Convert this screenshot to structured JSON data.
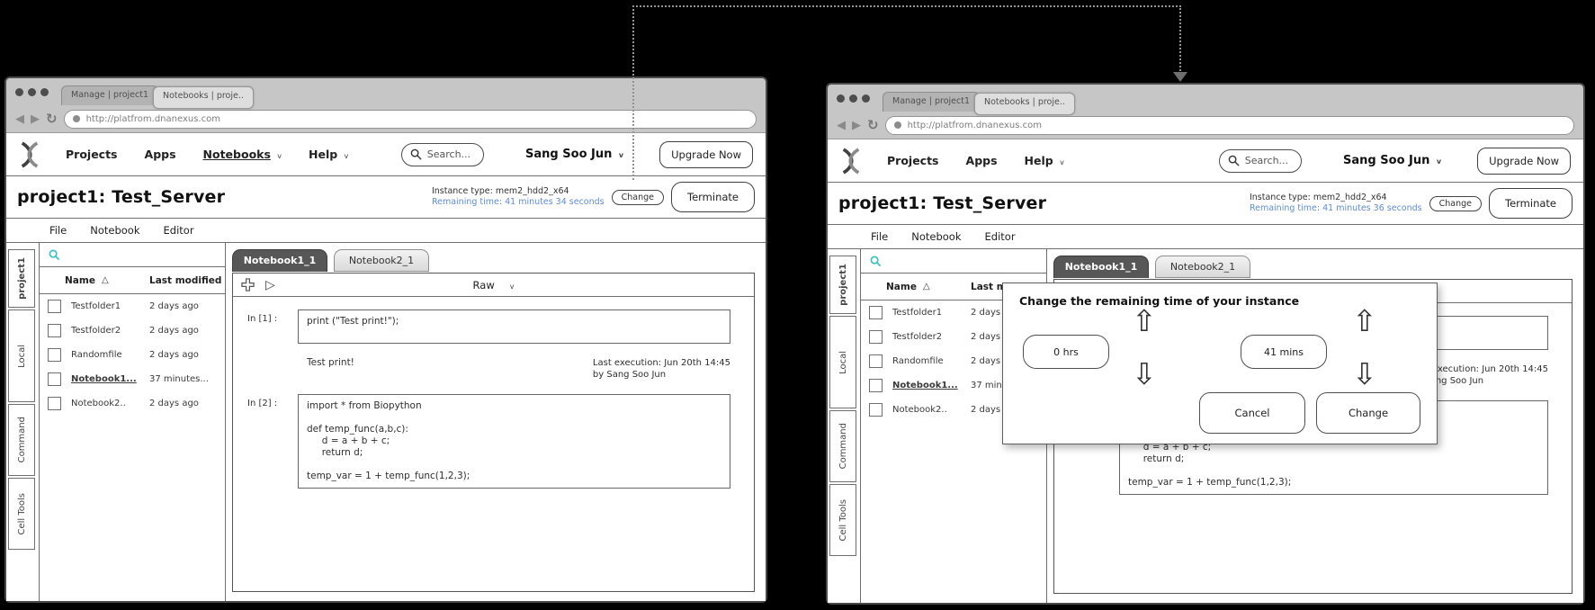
{
  "colors": {
    "link_blue": "#5f8dd3",
    "file_search_teal": "#3cc2c2",
    "selected_tab_gray": "#575757",
    "connector_gray": "#939393"
  },
  "icons": {
    "caret": "v",
    "sort": "△",
    "play": "▷",
    "back": "◀",
    "forward": "▶",
    "reload": "↻",
    "up_arrow": "⇧",
    "down_arrow": "⇩"
  },
  "browser": {
    "tab1": "Manage | project1",
    "tab2": "Notebooks | proje..",
    "url": "http://platfrom.dnanexus.com"
  },
  "nav": {
    "projects": "Projects",
    "apps": "Apps",
    "notebooks": "Notebooks",
    "help": "Help",
    "search": "Search...",
    "user": "Sang Soo Jun",
    "upgrade": "Upgrade Now"
  },
  "header": {
    "title": "project1: Test_Server",
    "instance_type": "Instance type: mem2_hdd2_x64",
    "remaining_left": "Remaining time: 41 minutes 34 seconds",
    "remaining_right": "Remaining time: 41 minutes 36 seconds",
    "change": "Change",
    "terminate": "Terminate"
  },
  "menus": {
    "file": "File",
    "notebook": "Notebook",
    "editor": "Editor"
  },
  "side_tabs": [
    "project1",
    "Local",
    "Command",
    "Cell Tools"
  ],
  "file_panel": {
    "col_name": "Name",
    "col_modified": "Last modified",
    "rows": [
      {
        "name": "Testfolder1",
        "modified": "2 days ago"
      },
      {
        "name": "Testfolder2",
        "modified": "2 days ago"
      },
      {
        "name": "Randomfile",
        "modified": "2 days ago"
      },
      {
        "name": "Notebook1...",
        "modified": "37 minutes..."
      },
      {
        "name": "Notebook2..",
        "modified": "2 days ago"
      }
    ]
  },
  "notebook": {
    "tab1": "Notebook1_1",
    "tab2": "Notebook2_1",
    "mode": "Raw",
    "cell1_label": "In [1] :",
    "cell1_code": "print (\"Test print!\");",
    "cell1_output": "Test print!",
    "exec_line1": "Last execution: Jun 20th 14:45",
    "exec_line2": "by Sang Soo Jun",
    "cell2_label": "In [2] :",
    "cell2_lines": [
      "import * from Biopython",
      "",
      "def temp_func(a,b,c):",
      "     d = a + b + c;",
      "     return d;",
      "",
      "temp_var = 1 + temp_func(1,2,3);"
    ]
  },
  "modal": {
    "title": "Change the remaining time of your instance",
    "hours": "0 hrs",
    "minutes": "41 mins",
    "cancel": "Cancel",
    "change": "Change"
  }
}
